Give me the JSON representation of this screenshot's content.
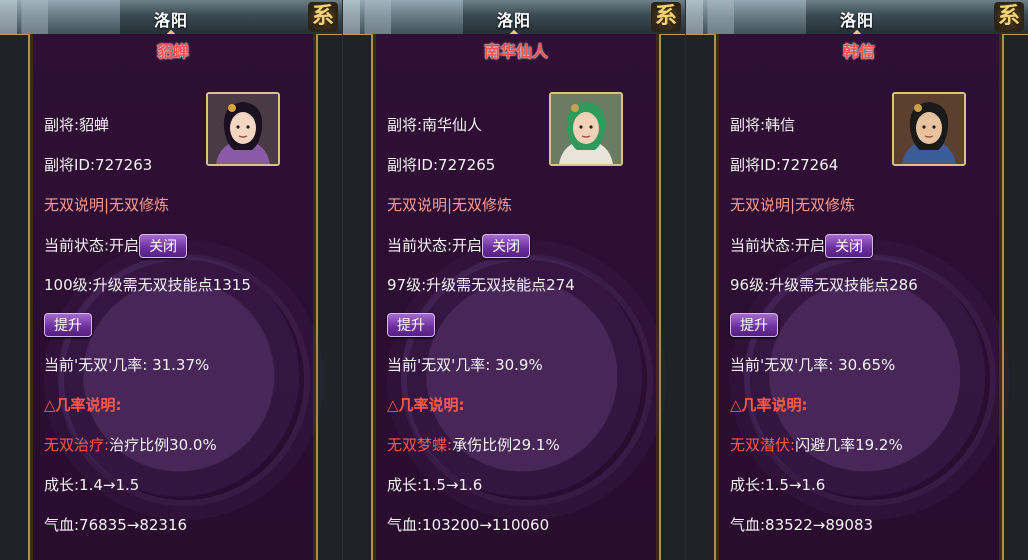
{
  "panels": [
    {
      "city": "洛阳",
      "system_icon": "系",
      "general_name": "貂蝉",
      "deputy_label": "副将:貂蝉",
      "deputy_id": "副将ID:727263",
      "skill_links": "无双说明|无双修炼",
      "status_label": "当前状态:开启",
      "close_button": "关闭",
      "upgrade_text": "100级:升级需无双技能点1315",
      "upgrade_button": "提升",
      "rate_text": "当前'无双'几率: 31.37%",
      "rate_info_title": "△几率说明:",
      "skill_name": "无双治疗:",
      "skill_effect": "治疗比例30.0%",
      "growth": "成长:1.4→1.5",
      "hp": "气血:76835→82316",
      "portrait_icon": "female-general-portrait",
      "portrait_colors": {
        "hair": "#1b1020",
        "skin": "#f3d6c4",
        "robe": "#8a5aa8",
        "bg": "#4a3a44",
        "accent": "#d7a33a"
      }
    },
    {
      "city": "洛阳",
      "system_icon": "系",
      "general_name": "南华仙人",
      "deputy_label": "副将:南华仙人",
      "deputy_id": "副将ID:727265",
      "skill_links": "无双说明|无双修炼",
      "status_label": "当前状态:开启",
      "close_button": "关闭",
      "upgrade_text": "97级:升级需无双技能点274",
      "upgrade_button": "提升",
      "rate_text": "当前'无双'几率: 30.9%",
      "rate_info_title": "△几率说明:",
      "skill_name": "无双梦蝶:",
      "skill_effect": "承伤比例29.1%",
      "growth": "成长:1.5→1.6",
      "hp": "气血:103200→110060",
      "portrait_icon": "green-hair-sage-portrait",
      "portrait_colors": {
        "hair": "#2e9a5c",
        "skin": "#f2d2b6",
        "robe": "#e9e4d8",
        "bg": "#6b7b64",
        "accent": "#c8a050"
      }
    },
    {
      "city": "洛阳",
      "system_icon": "系",
      "general_name": "韩信",
      "deputy_label": "副将:韩信",
      "deputy_id": "副将ID:727264",
      "skill_links": "无双说明|无双修炼",
      "status_label": "当前状态:开启",
      "close_button": "关闭",
      "upgrade_text": "96级:升级需无双技能点286",
      "upgrade_button": "提升",
      "rate_text": "当前'无双'几率: 30.65%",
      "rate_info_title": "△几率说明:",
      "skill_name": "无双潜伏:",
      "skill_effect": "闪避几率19.2%",
      "growth": "成长:1.5→1.6",
      "hp": "气血:83522→89083",
      "portrait_icon": "armored-general-portrait",
      "portrait_colors": {
        "hair": "#1a1a1a",
        "skin": "#e8c3a0",
        "robe": "#3a5d9a",
        "bg": "#5b4030",
        "accent": "#c9a24a"
      }
    }
  ]
}
